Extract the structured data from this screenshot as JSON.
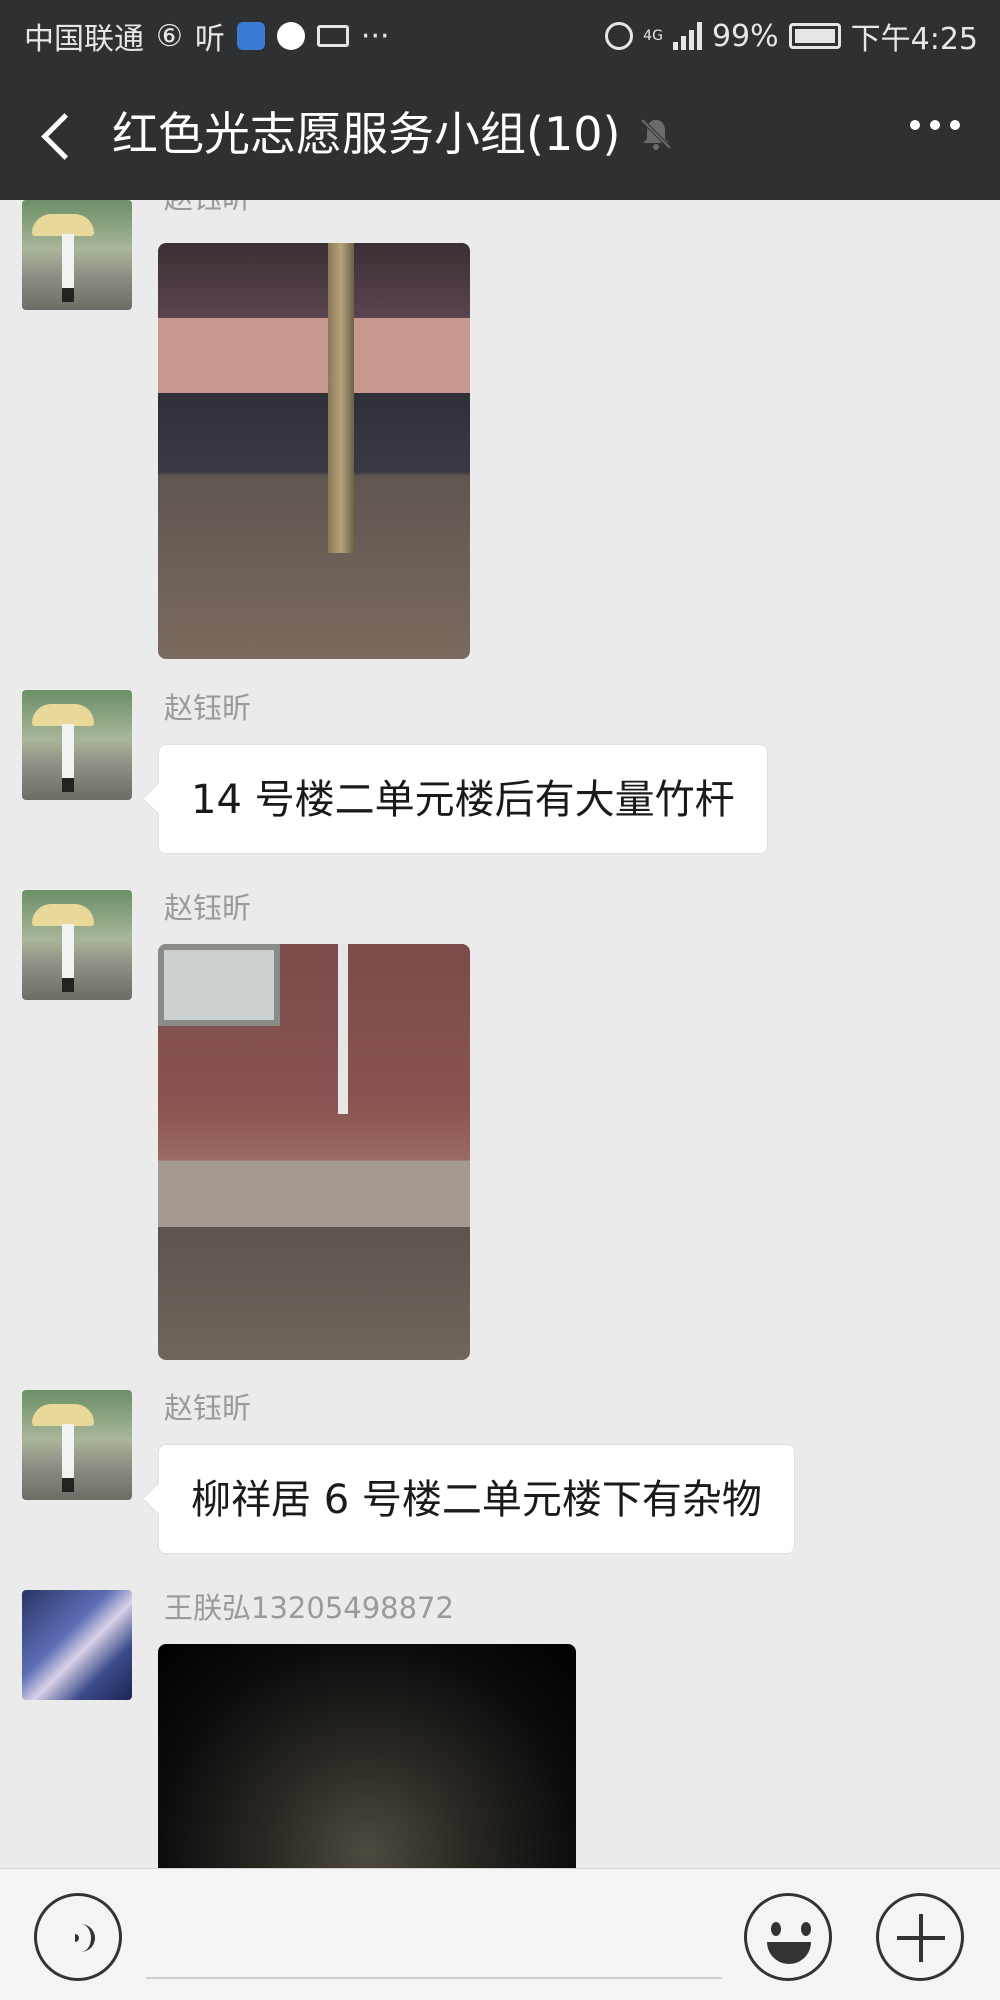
{
  "status_bar": {
    "carrier": "中国联通",
    "listen_app": "听",
    "more": "···",
    "network": "4G",
    "battery": "99%",
    "time": "下午4:25"
  },
  "header": {
    "title": "红色光志愿服务小组(10)"
  },
  "messages": [
    {
      "sender": "赵钰昕",
      "type": "image",
      "avatar": "umbrella-photo"
    },
    {
      "sender": "赵钰昕",
      "type": "text",
      "text": "14 号楼二单元楼后有大量竹杆",
      "avatar": "umbrella-photo"
    },
    {
      "sender": "赵钰昕",
      "type": "image",
      "avatar": "umbrella-photo"
    },
    {
      "sender": "赵钰昕",
      "type": "text",
      "text": "柳祥居 6 号楼二单元楼下有杂物",
      "avatar": "umbrella-photo"
    },
    {
      "sender": "王朕弘13205498872",
      "type": "image",
      "avatar": "anime-photo"
    }
  ],
  "input_bar": {
    "icons": [
      "voice-icon",
      "emoji-icon",
      "plus-icon"
    ]
  },
  "colors": {
    "header_bg": "#2f3032",
    "chat_bg": "#ebebeb",
    "bubble_bg": "#ffffff",
    "sender_text": "#9a9a9a"
  }
}
